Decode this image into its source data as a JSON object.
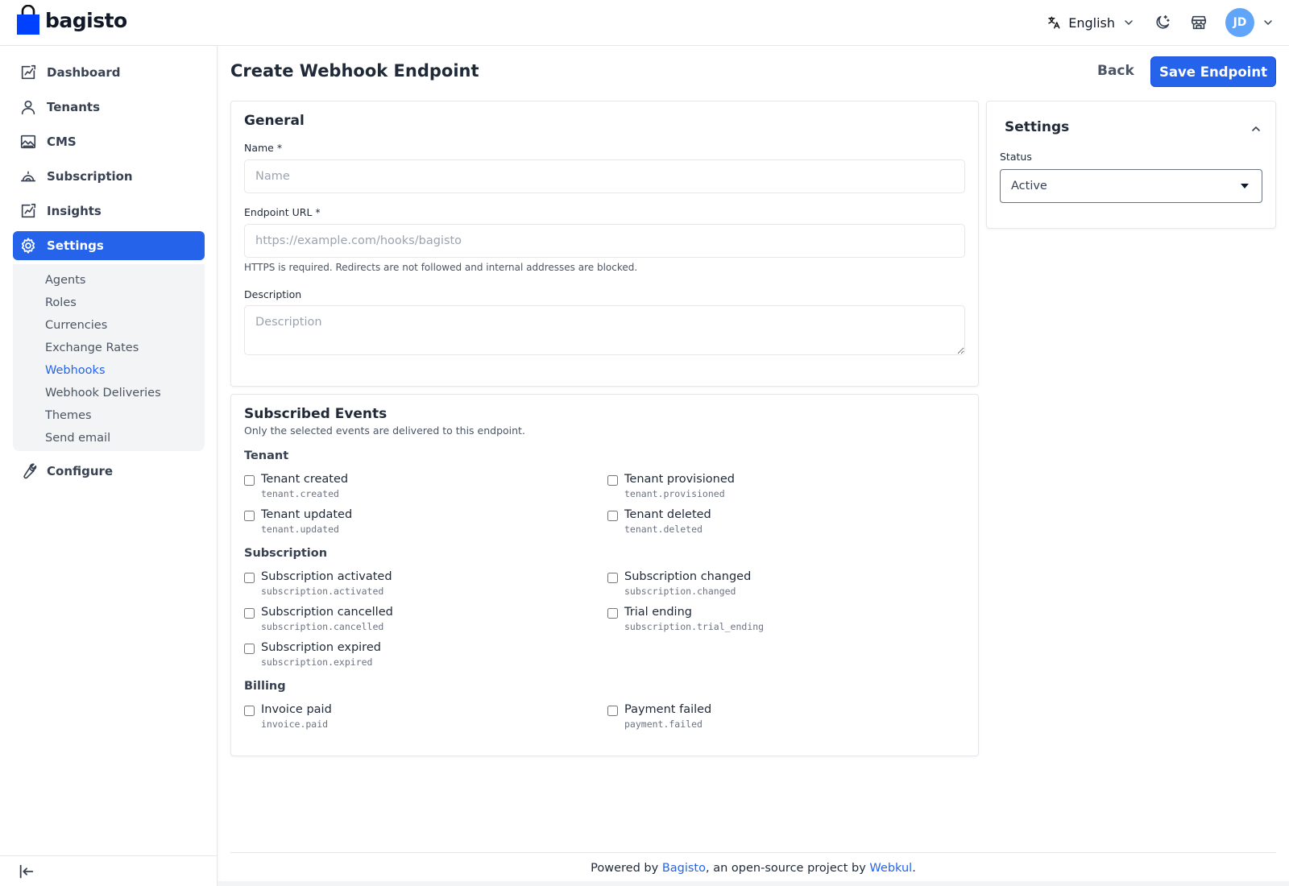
{
  "brand": {
    "name": "bagisto",
    "color": "#0041ff"
  },
  "header": {
    "language": "English",
    "avatar_initials": "JD",
    "icons": [
      "language-icon",
      "chevron-down-icon",
      "dark-mode-icon",
      "storefront-icon",
      "chevron-down-icon"
    ]
  },
  "sidebar": {
    "items": [
      {
        "label": "Dashboard",
        "icon": "dashboard-icon"
      },
      {
        "label": "Tenants",
        "icon": "user-icon"
      },
      {
        "label": "CMS",
        "icon": "cms-icon"
      },
      {
        "label": "Subscription",
        "icon": "subscription-icon"
      },
      {
        "label": "Insights",
        "icon": "insights-icon"
      },
      {
        "label": "Settings",
        "icon": "gear-icon",
        "active": true
      },
      {
        "label": "Configure",
        "icon": "wrench-icon"
      }
    ],
    "settings_children": [
      {
        "label": "Agents"
      },
      {
        "label": "Roles"
      },
      {
        "label": "Currencies"
      },
      {
        "label": "Exchange Rates"
      },
      {
        "label": "Webhooks",
        "active": true
      },
      {
        "label": "Webhook Deliveries"
      },
      {
        "label": "Themes"
      },
      {
        "label": "Send email"
      }
    ]
  },
  "page": {
    "title": "Create Webhook Endpoint",
    "back_label": "Back",
    "save_label": "Save Endpoint"
  },
  "general": {
    "title": "General",
    "name_label": "Name *",
    "name_placeholder": "Name",
    "url_label": "Endpoint URL *",
    "url_placeholder": "https://example.com/hooks/bagisto",
    "url_hint": "HTTPS is required. Redirects are not followed and internal addresses are blocked.",
    "description_label": "Description",
    "description_placeholder": "Description"
  },
  "events": {
    "title": "Subscribed Events",
    "subtitle": "Only the selected events are delivered to this endpoint.",
    "groups": [
      {
        "title": "Tenant",
        "items": [
          {
            "label": "Tenant created",
            "key": "tenant.created",
            "checked": false
          },
          {
            "label": "Tenant provisioned",
            "key": "tenant.provisioned",
            "checked": false
          },
          {
            "label": "Tenant updated",
            "key": "tenant.updated",
            "checked": false
          },
          {
            "label": "Tenant deleted",
            "key": "tenant.deleted",
            "checked": false
          }
        ]
      },
      {
        "title": "Subscription",
        "items": [
          {
            "label": "Subscription activated",
            "key": "subscription.activated",
            "checked": false
          },
          {
            "label": "Subscription changed",
            "key": "subscription.changed",
            "checked": false
          },
          {
            "label": "Subscription cancelled",
            "key": "subscription.cancelled",
            "checked": false
          },
          {
            "label": "Trial ending",
            "key": "subscription.trial_ending",
            "checked": false
          },
          {
            "label": "Subscription expired",
            "key": "subscription.expired",
            "checked": false
          }
        ]
      },
      {
        "title": "Billing",
        "items": [
          {
            "label": "Invoice paid",
            "key": "invoice.paid",
            "checked": false
          },
          {
            "label": "Payment failed",
            "key": "payment.failed",
            "checked": false
          }
        ]
      }
    ]
  },
  "settings_panel": {
    "title": "Settings",
    "status_label": "Status",
    "status_value": "Active"
  },
  "footer": {
    "prefix": "Powered by ",
    "link1": "Bagisto",
    "middle": ", an open-source project by ",
    "link2": "Webkul",
    "suffix": "."
  },
  "colors": {
    "primary": "#2563eb",
    "border": "#e5e7eb",
    "muted": "#4b5563"
  }
}
